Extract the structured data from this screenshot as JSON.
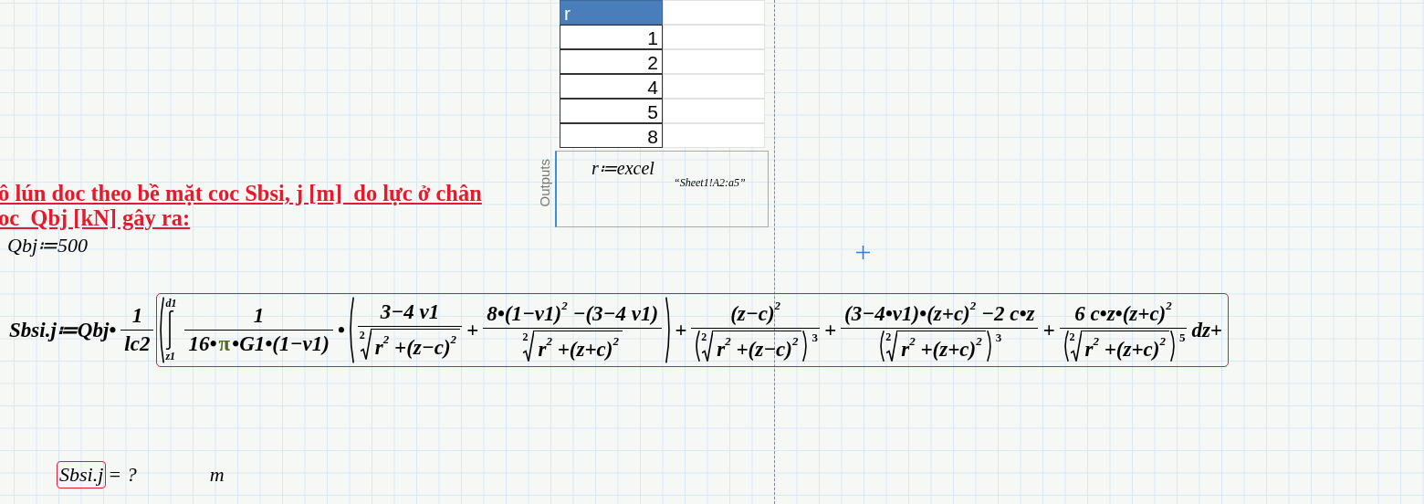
{
  "table": {
    "header": "r",
    "rows": [
      "1",
      "2",
      "4",
      "5",
      "8"
    ]
  },
  "outputs_panel": {
    "label": "Outputs",
    "expression": "r≔excel",
    "argument": "“Sheet1!A2:a5”"
  },
  "heading": {
    "lines": [
      "ô lún doc theo bề mặt coc Sbsi, j [m]  do lực ở chân",
      "oc  Qbj [kN] gây ra:"
    ]
  },
  "definition": "Qbj≔500",
  "formula": {
    "kind": "row",
    "items": [
      {
        "kind": "text",
        "text": "Sbsi.j≔Qbj•"
      },
      {
        "kind": "frac",
        "num": {
          "kind": "text",
          "text": "1"
        },
        "den": {
          "kind": "text",
          "text": "lc2"
        }
      },
      {
        "kind": "region",
        "error": true,
        "body": {
          "kind": "openparen",
          "body": {
            "kind": "integral",
            "upper": "d1",
            "lower": "z1",
            "body": {
              "kind": "row",
              "items": [
                {
                  "kind": "frac",
                  "num": {
                    "kind": "text",
                    "text": "1"
                  },
                  "den": {
                    "kind": "row",
                    "items": [
                      {
                        "kind": "text",
                        "text": "16•"
                      },
                      {
                        "kind": "const",
                        "text": "π"
                      },
                      {
                        "kind": "text",
                        "text": "•G1•(1−v1)"
                      }
                    ]
                  }
                },
                {
                  "kind": "text",
                  "text": "•"
                },
                {
                  "kind": "paren",
                  "body": {
                    "kind": "row",
                    "items": [
                      {
                        "kind": "frac",
                        "num": {
                          "kind": "text",
                          "text": "3−4 v1"
                        },
                        "den": {
                          "kind": "sqrt",
                          "index": "2",
                          "body": {
                            "kind": "text",
                            "text": "r$^{2}$ +(z−c)$^{2}$"
                          }
                        }
                      },
                      {
                        "kind": "text",
                        "text": "+"
                      },
                      {
                        "kind": "frac",
                        "num": {
                          "kind": "text",
                          "text": "8•(1−v1)$^{2}$ −(3−4 v1)"
                        },
                        "den": {
                          "kind": "sqrt",
                          "index": "2",
                          "body": {
                            "kind": "text",
                            "text": "r$^{2}$ +(z+c)$^{2}$"
                          }
                        }
                      }
                    ]
                  }
                },
                {
                  "kind": "text",
                  "text": "+"
                },
                {
                  "kind": "frac",
                  "num": {
                    "kind": "text",
                    "text": "(z−c)$^{2}$"
                  },
                  "den": {
                    "kind": "paren",
                    "exp": "3",
                    "body": {
                      "kind": "sqrt",
                      "index": "2",
                      "body": {
                        "kind": "text",
                        "text": "r$^{2}$ +(z−c)$^{2}$"
                      }
                    }
                  }
                },
                {
                  "kind": "text",
                  "text": "+"
                },
                {
                  "kind": "frac",
                  "num": {
                    "kind": "text",
                    "text": "(3−4•v1)•(z+c)$^{2}$ −2 c•z"
                  },
                  "den": {
                    "kind": "paren",
                    "exp": "3",
                    "body": {
                      "kind": "sqrt",
                      "index": "2",
                      "body": {
                        "kind": "text",
                        "text": "r$^{2}$ +(z+c)$^{2}$"
                      }
                    }
                  }
                },
                {
                  "kind": "text",
                  "text": "+"
                },
                {
                  "kind": "frac",
                  "num": {
                    "kind": "text",
                    "text": "6 c•z•(z+c)$^{2}$"
                  },
                  "den": {
                    "kind": "paren",
                    "exp": "5",
                    "body": {
                      "kind": "sqrt",
                      "index": "2",
                      "body": {
                        "kind": "text",
                        "text": "r$^{2}$ +(z+c)$^{2}$"
                      }
                    }
                  }
                },
                {
                  "kind": "text",
                  "text": "dz+"
                }
              ]
            }
          }
        }
      }
    ]
  },
  "result": {
    "name": "Sbsi.j",
    "value": "= ?",
    "unit": "m",
    "error": true
  }
}
